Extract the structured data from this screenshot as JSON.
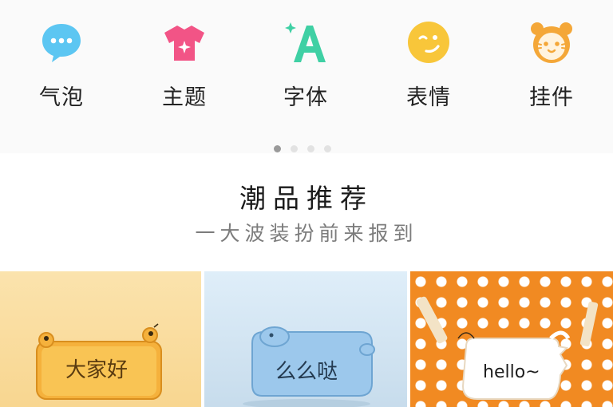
{
  "categories": [
    {
      "label": "气泡",
      "icon": "chat-bubble-icon",
      "color": "#5cc6f2"
    },
    {
      "label": "主题",
      "icon": "tshirt-icon",
      "color": "#f25486"
    },
    {
      "label": "字体",
      "icon": "font-a-icon",
      "color": "#3fd0a4"
    },
    {
      "label": "表情",
      "icon": "smiley-icon",
      "color": "#f8c63a"
    },
    {
      "label": "挂件",
      "icon": "cat-face-icon",
      "color": "#f4a738"
    }
  ],
  "carousel": {
    "pages": 4,
    "active": 1
  },
  "section": {
    "title": "潮品推荐",
    "subtitle": "一大波装扮前来报到"
  },
  "recommendations": [
    {
      "bubble_text": "大家好",
      "icon": "orange-bubble-sticker"
    },
    {
      "bubble_text": "么么哒",
      "icon": "blue-bubble-sticker"
    },
    {
      "bubble_text": "hello~",
      "icon": "white-cloud-bubble-sticker"
    }
  ]
}
